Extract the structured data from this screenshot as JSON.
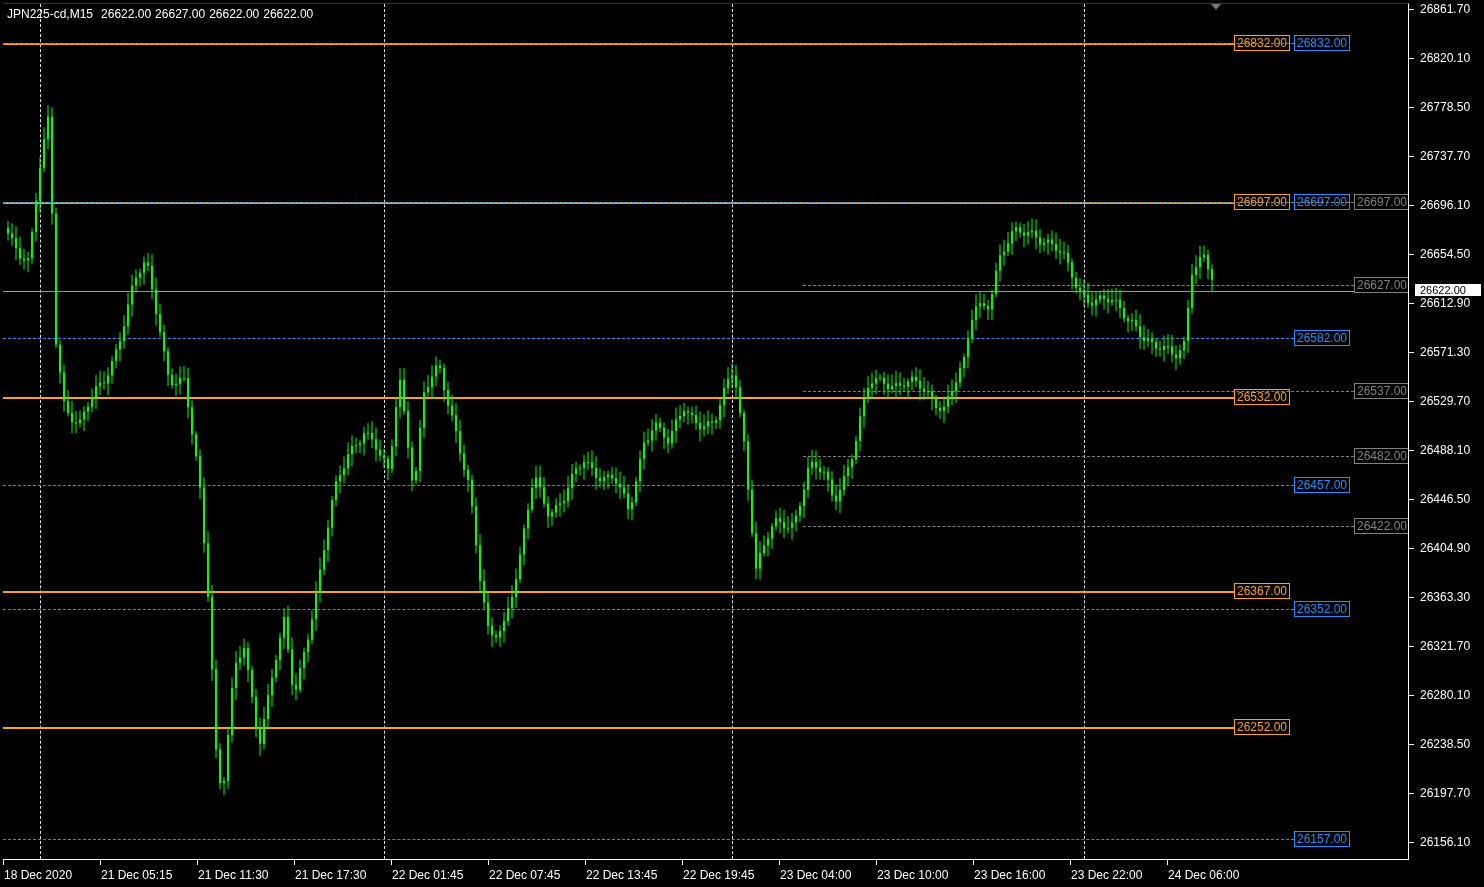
{
  "header": {
    "symbol": "JPN225-cd,M15",
    "prices": [
      "26622.00",
      "26627.00",
      "26622.00",
      "26622.00"
    ]
  },
  "levels": [
    {
      "label": "26832.00",
      "kind": "solid",
      "color": "#ffa500"
    },
    {
      "label": "26832.00",
      "kind": "dashed",
      "color": "#1e90ff"
    },
    {
      "label": "26697.00",
      "kind": "solid",
      "color": "#ffa500"
    },
    {
      "label": "26697.00",
      "kind": "dashed",
      "color": "#1e90ff"
    },
    {
      "label": "26697.00",
      "kind": "partial",
      "color": "#808080"
    },
    {
      "label": "26627.00",
      "kind": "partial",
      "color": "#808080"
    },
    {
      "label": "26582.00",
      "kind": "dashed",
      "color": "#1e90ff"
    },
    {
      "label": "26532.00",
      "kind": "solid",
      "color": "#ffa500"
    },
    {
      "label": "26537.00",
      "kind": "partial",
      "color": "#808080"
    },
    {
      "label": "26482.00",
      "kind": "partial",
      "color": "#808080"
    },
    {
      "label": "26457.00",
      "kind": "dashed",
      "color": "#1e90ff"
    },
    {
      "label": "26422.00",
      "kind": "partial",
      "color": "#808080"
    },
    {
      "label": "26367.00",
      "kind": "solid",
      "color": "#ffa500"
    },
    {
      "label": "26352.00",
      "kind": "dashed",
      "color": "#1e90ff"
    },
    {
      "label": "26252.00",
      "kind": "solid",
      "color": "#ffa500"
    },
    {
      "label": "26157.00",
      "kind": "dashed",
      "color": "#1e90ff"
    }
  ],
  "price_axis": {
    "ticks": [
      "26861.70",
      "26820.10",
      "26778.50",
      "26737.70",
      "26696.10",
      "26654.50",
      "26612.90",
      "26571.30",
      "26529.70",
      "26488.10",
      "26446.50",
      "26404.90",
      "26363.30",
      "26321.70",
      "26280.10",
      "26238.50",
      "26197.70",
      "26156.10"
    ],
    "current": "26622.00"
  },
  "time_axis": {
    "labels": [
      "18 Dec 2020",
      "21 Dec 05:15",
      "21 Dec 11:30",
      "21 Dec 17:30",
      "22 Dec 01:45",
      "22 Dec 07:45",
      "22 Dec 13:45",
      "22 Dec 19:45",
      "23 Dec 04:00",
      "23 Dec 10:00",
      "23 Dec 16:00",
      "23 Dec 22:00",
      "24 Dec 06:00"
    ]
  }
}
